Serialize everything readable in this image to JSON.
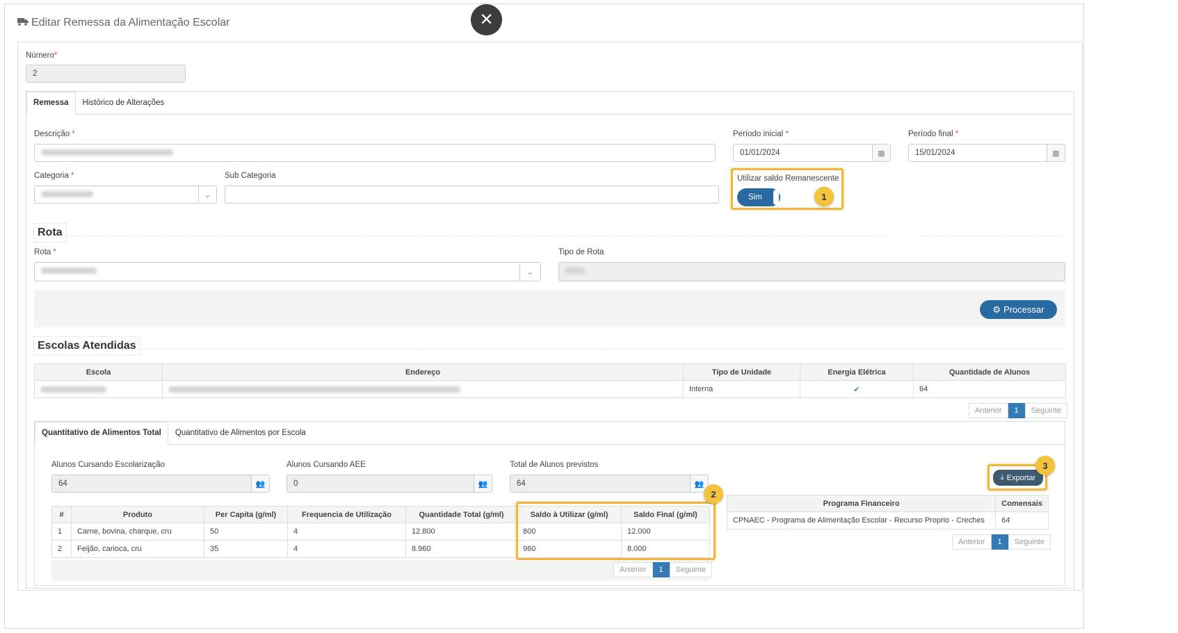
{
  "modal": {
    "title": "Editar Remessa da Alimentação Escolar",
    "close_icon": "close-icon",
    "title_icon": "truck-icon"
  },
  "numero": {
    "label": "Número",
    "required_mark": "*",
    "value": "2"
  },
  "tabs": [
    {
      "label": "Remessa",
      "active": true
    },
    {
      "label": "Histórico de Alterações",
      "active": false
    }
  ],
  "form": {
    "descricao_label": "Descrição",
    "periodo_inicial_label": "Período inicial",
    "periodo_inicial_value": "01/01/2024",
    "periodo_final_label": "Período final",
    "periodo_final_value": "15/01/2024",
    "categoria_label": "Categoria",
    "sub_categoria_label": "Sub Categoria",
    "utilizar_saldo_label": "Utilizar saldo Remanescente",
    "utilizar_saldo_value": "Sim",
    "required_mark": "*"
  },
  "rota_section": {
    "title": "Rota",
    "rota_label": "Rota",
    "tipo_rota_label": "Tipo de Rota",
    "processar_label": "Processar"
  },
  "escolas": {
    "title": "Escolas Atendidas",
    "columns": [
      "Escola",
      "Endereço",
      "Tipo de Unidade",
      "Energia Elétrica",
      "Quantidade de Alunos"
    ],
    "rows": [
      {
        "tipo": "Interna",
        "energia": "✔",
        "qtd": "64"
      }
    ],
    "pager": {
      "prev": "Anterior",
      "page": "1",
      "next": "Seguinte"
    }
  },
  "food_tabs": [
    {
      "label": "Quantitativo de Alimentos Total",
      "active": true
    },
    {
      "label": "Quantitativo de Alimentos por Escola",
      "active": false
    }
  ],
  "alunos": {
    "escolarizacao_label": "Alunos Cursando Escolarização",
    "escolarizacao_value": "64",
    "aee_label": "Alunos Cursando AEE",
    "aee_value": "0",
    "total_label": "Total de Alunos previstos",
    "total_value": "64"
  },
  "exportar_label": "Exportar",
  "produtos": {
    "columns": [
      "#",
      "Produto",
      "Per Capita (g/ml)",
      "Frequencia de Utilização",
      "Quantidade Total (g/ml)",
      "Saldo à Utilizar (g/ml)",
      "Saldo Final (g/ml)"
    ],
    "rows": [
      [
        "1",
        "Carne, bovina, charque, cru",
        "50",
        "4",
        "12.800",
        "800",
        "12.000"
      ],
      [
        "2",
        "Feijão, carioca, cru",
        "35",
        "4",
        "8.960",
        "960",
        "8.000"
      ]
    ],
    "pager": {
      "prev": "Anterior",
      "page": "1",
      "next": "Seguinte"
    }
  },
  "programa": {
    "columns": [
      "Programa Financeiro",
      "Comensais"
    ],
    "rows": [
      [
        "CPNAEC - Programa de Alimentação Escolar - Recurso Proprio - Creches",
        "64"
      ]
    ],
    "pager": {
      "prev": "Anterior",
      "page": "1",
      "next": "Seguinte"
    }
  },
  "callouts": [
    "1",
    "2",
    "3"
  ],
  "colors": {
    "primary": "#2a6aa3",
    "highlight": "#f0b63c",
    "callout": "#f4c33d",
    "required": "#d9534f"
  }
}
